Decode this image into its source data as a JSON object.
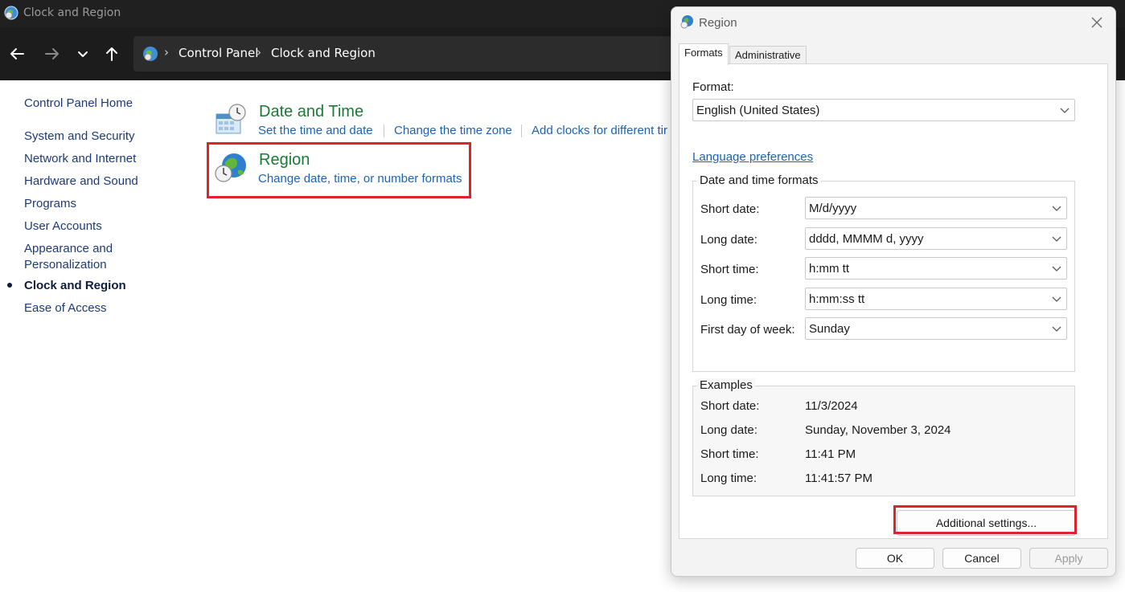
{
  "window": {
    "title": "Clock and Region"
  },
  "address_bar": {
    "crumbs": [
      "Control Panel",
      "Clock and Region"
    ]
  },
  "left_nav": {
    "home": "Control Panel Home",
    "items": [
      "System and Security",
      "Network and Internet",
      "Hardware and Sound",
      "Programs",
      "User Accounts",
      "Appearance and",
      "Personalization",
      "Clock and Region",
      "Ease of Access"
    ]
  },
  "categories": {
    "date_time": {
      "title": "Date and Time",
      "links": [
        "Set the time and date",
        "Change the time zone",
        "Add clocks for different tir"
      ]
    },
    "region": {
      "title": "Region",
      "link": "Change date, time, or number formats"
    }
  },
  "dialog": {
    "title": "Region",
    "tabs": [
      "Formats",
      "Administrative"
    ],
    "format_label": "Format:",
    "format_value": "English (United States)",
    "language_link": "Language preferences",
    "dt_group_label": "Date and time formats",
    "dt_rows": [
      {
        "label": "Short date:",
        "value": "M/d/yyyy"
      },
      {
        "label": "Long date:",
        "value": "dddd, MMMM d, yyyy"
      },
      {
        "label": "Short time:",
        "value": "h:mm tt"
      },
      {
        "label": "Long time:",
        "value": "h:mm:ss tt"
      },
      {
        "label": "First day of week:",
        "value": "Sunday"
      }
    ],
    "examples_label": "Examples",
    "examples": [
      {
        "label": "Short date:",
        "value": "11/3/2024"
      },
      {
        "label": "Long date:",
        "value": "Sunday, November 3, 2024"
      },
      {
        "label": "Short time:",
        "value": "11:41 PM"
      },
      {
        "label": "Long time:",
        "value": "11:41:57 PM"
      }
    ],
    "additional_settings": "Additional settings...",
    "ok": "OK",
    "cancel": "Cancel",
    "apply": "Apply"
  },
  "colors": {
    "highlight": "#e0232b",
    "link": "#1a63b8",
    "category_title": "#1b7a34"
  }
}
